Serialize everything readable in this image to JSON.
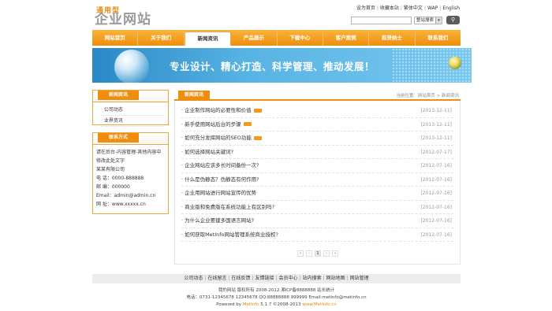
{
  "logo": {
    "small": "通用型",
    "big": "企业网站"
  },
  "toplinks": [
    "设为首页",
    "收藏本站",
    "繁体中文",
    "WAP",
    "English"
  ],
  "search": {
    "select_label": "整站搜索",
    "button_icon": "search-icon"
  },
  "nav": [
    "网站首页",
    "关于我们",
    "新闻资讯",
    "产品展示",
    "下载中心",
    "客户案例",
    "招贤纳士",
    "联系我们"
  ],
  "banner": {
    "slogan": "专业设计、精心打造、科学管理、推动发展！"
  },
  "sidebar": {
    "news_tab": "新闻资讯",
    "news_items": [
      "公司动态",
      "业界资讯"
    ],
    "contact_tab": "联系方式",
    "contact_lines": [
      "请在后台-内容管理-其他内容中",
      "修改此处文字",
      "某某有限公司",
      "电  话：0000-888888",
      "邮  编：000000",
      "Email：admin@admin.cn",
      "网  址：www.xxxxx.cn"
    ]
  },
  "main": {
    "tab": "新闻资讯",
    "breadcrumb": "当前位置：网站首页 > 新闻资讯",
    "news": [
      {
        "title": "企业制作网站的必要性和价值",
        "date": "[2013-12-11]",
        "hot": true
      },
      {
        "title": "新手使用网站后台的步骤",
        "date": "[2013-12-11]",
        "hot": true
      },
      {
        "title": "如何充分发挥网站的SEO功能",
        "date": "[2013-12-11]",
        "hot": true
      },
      {
        "title": "如何选择网站关键词?",
        "date": "[2012-07-17]",
        "hot": false
      },
      {
        "title": "企业网站应该多长时间备份一次?",
        "date": "[2012-07-16]",
        "hot": false
      },
      {
        "title": "什么是伪静态？伪静态有何作用?",
        "date": "[2012-07-16]",
        "hot": false
      },
      {
        "title": "企业用网站进行网站宣传的优势",
        "date": "[2012-07-16]",
        "hot": false
      },
      {
        "title": "商业版和免费版在系统功能上有区别吗?",
        "date": "[2012-07-16]",
        "hot": false
      },
      {
        "title": "为什么企业要建多国语言网站?",
        "date": "[2012-07-16]",
        "hot": false
      },
      {
        "title": "如何获取MetInfo网站管理系统商业授权?",
        "date": "[2012-07-16]",
        "hot": false
      }
    ],
    "pager": [
      "«",
      "‹",
      "1",
      "›",
      "»"
    ]
  },
  "footer": {
    "links": [
      "公司动态",
      "在线留言",
      "在线反馈",
      "友情链接",
      "会员中心",
      "站内搜索",
      "网站地图",
      "网站管理"
    ],
    "line1": "我的网站 版权所有 2008-2012 湘ICP备8888888 站长统计",
    "line2": "电话：0731-12345678 12345678  QQ:88888888 999999  Email:metinfo@metinfo.cn",
    "line3_prefix": "Powered by ",
    "line3_brand": "MetInfo",
    "line3_mid": " 5.1.7 ©2008-2013 ",
    "line3_site": "www.MetInfo.cn"
  }
}
